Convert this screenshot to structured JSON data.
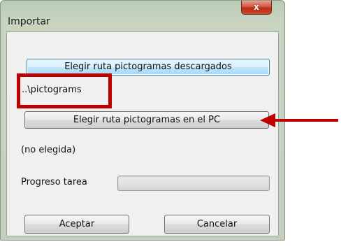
{
  "window": {
    "title": "Importar",
    "close_label": "x"
  },
  "buttons": {
    "choose_downloaded": "Elegir ruta pictogramas descargados",
    "choose_pc": "Elegir ruta pictogramas en el PC",
    "accept": "Aceptar",
    "cancel": "Cancelar"
  },
  "downloaded_path": "..\\pictograms",
  "pc_path": "(no elegida)",
  "progress": {
    "label": "Progreso tarea",
    "value_percent": 0
  },
  "annotations": {
    "highlight_color": "#c00000",
    "arrow_color": "#c00000"
  }
}
